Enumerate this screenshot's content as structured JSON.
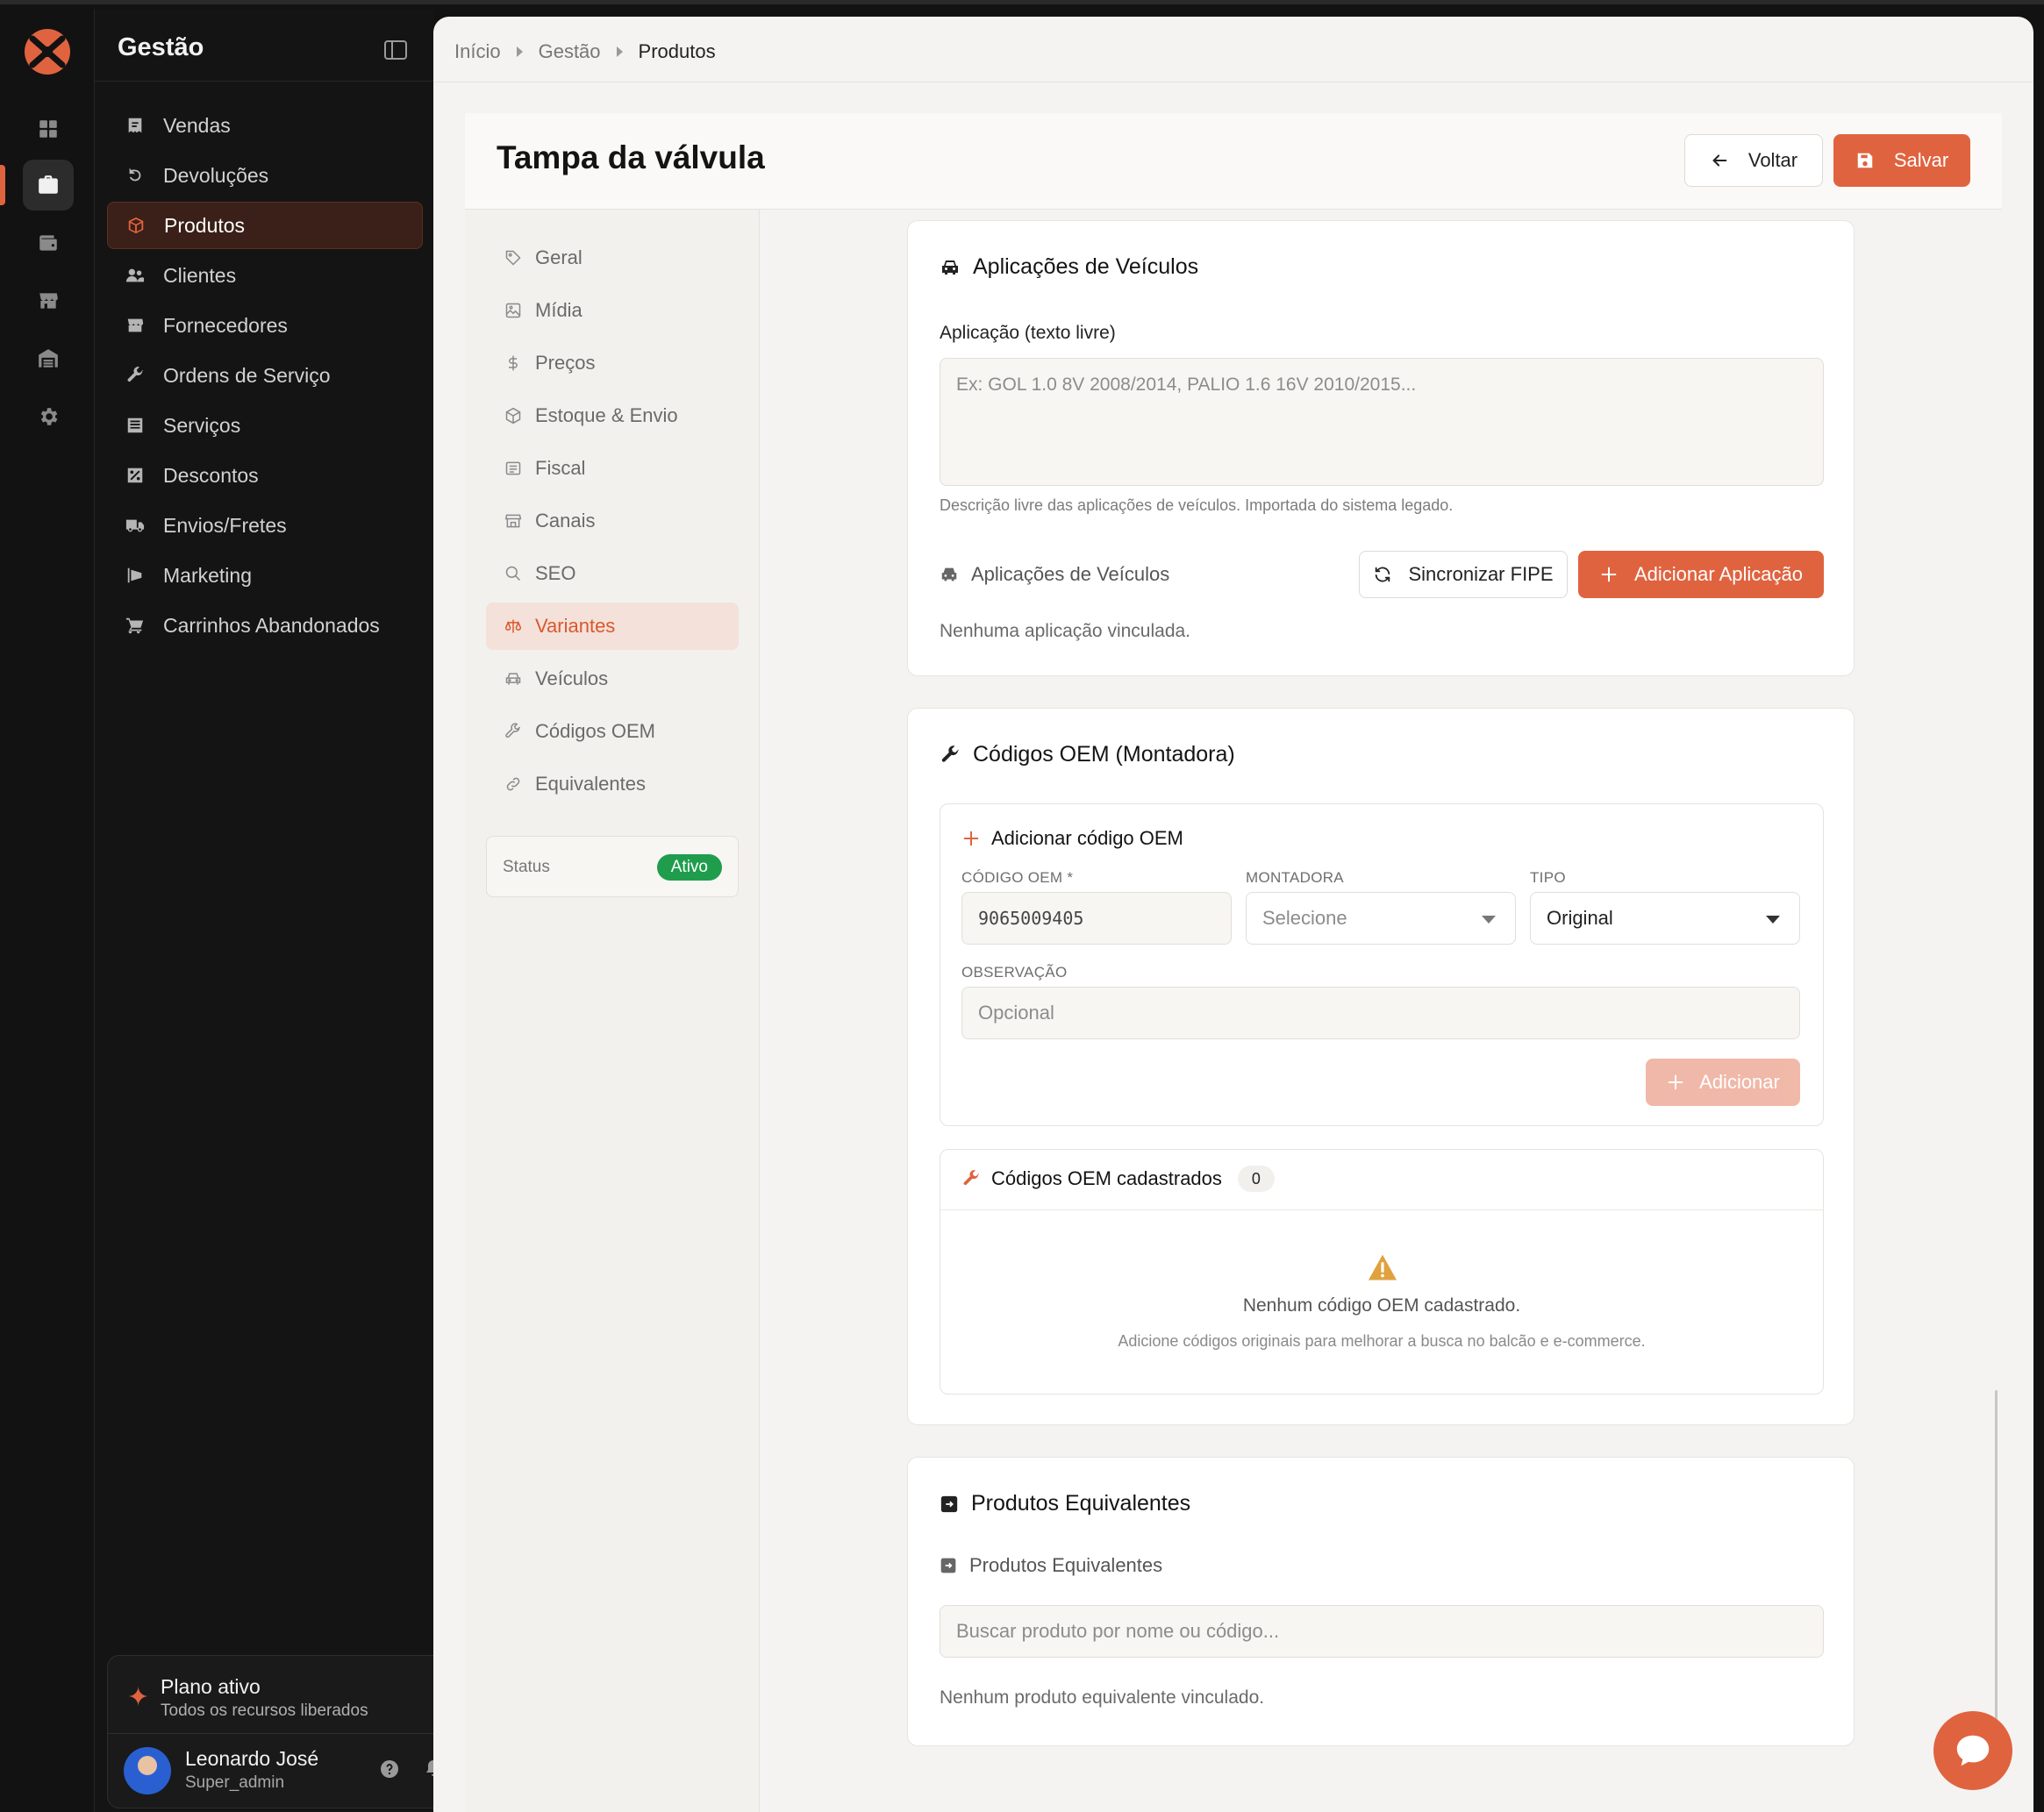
{
  "colors": {
    "accent": "#e0633f",
    "success": "#1f9d4d",
    "sidebar_bg": "#141414",
    "main_bg": "#f4f3f1"
  },
  "rail": {
    "icons": [
      "dashboard-icon",
      "briefcase-icon",
      "wallet-icon",
      "store-icon",
      "warehouse-icon",
      "gear-icon"
    ]
  },
  "sidebar": {
    "title": "Gestão",
    "items": [
      {
        "label": "Vendas",
        "icon": "receipt-icon"
      },
      {
        "label": "Devoluções",
        "icon": "undo-icon"
      },
      {
        "label": "Produtos",
        "icon": "box-icon"
      },
      {
        "label": "Clientes",
        "icon": "users-icon"
      },
      {
        "label": "Fornecedores",
        "icon": "store-icon"
      },
      {
        "label": "Ordens de Serviço",
        "icon": "wrench-icon"
      },
      {
        "label": "Serviços",
        "icon": "list-icon"
      },
      {
        "label": "Descontos",
        "icon": "percent-icon"
      },
      {
        "label": "Envios/Fretes",
        "icon": "truck-icon"
      },
      {
        "label": "Marketing",
        "icon": "megaphone-icon"
      },
      {
        "label": "Carrinhos Abandonados",
        "icon": "cart-icon"
      }
    ],
    "plan": {
      "title": "Plano ativo",
      "subtitle": "Todos os recursos liberados"
    },
    "user": {
      "name": "Leonardo José",
      "role": "Super_admin"
    }
  },
  "breadcrumb": [
    "Início",
    "Gestão",
    "Produtos"
  ],
  "header": {
    "title": "Tampa da válvula",
    "back_label": "Voltar",
    "save_label": "Salvar"
  },
  "subnav": {
    "items": [
      {
        "label": "Geral",
        "icon": "tag-icon"
      },
      {
        "label": "Mídia",
        "icon": "image-icon"
      },
      {
        "label": "Preços",
        "icon": "dollar-icon"
      },
      {
        "label": "Estoque & Envio",
        "icon": "package-icon"
      },
      {
        "label": "Fiscal",
        "icon": "document-icon"
      },
      {
        "label": "Canais",
        "icon": "store-icon"
      },
      {
        "label": "SEO",
        "icon": "search-icon"
      },
      {
        "label": "Variantes",
        "icon": "scale-icon"
      },
      {
        "label": "Veículos",
        "icon": "car-icon"
      },
      {
        "label": "Códigos OEM",
        "icon": "wrench-icon"
      },
      {
        "label": "Equivalentes",
        "icon": "link-icon"
      }
    ],
    "status_label": "Status",
    "status_value": "Ativo"
  },
  "vehicles": {
    "title": "Aplicações de Veículos",
    "field_label": "Aplicação (texto livre)",
    "textarea_placeholder": "Ex: GOL 1.0 8V 2008/2014, PALIO 1.6 16V 2010/2015...",
    "hint": "Descrição livre das aplicações de veículos. Importada do sistema legado.",
    "sub_label": "Aplicações de Veículos",
    "sync_label": "Sincronizar FIPE",
    "add_label": "Adicionar Aplicação",
    "empty": "Nenhuma aplicação vinculada."
  },
  "oem": {
    "title": "Códigos OEM (Montadora)",
    "add_title": "Adicionar código OEM",
    "code_label": "CÓDIGO OEM *",
    "code_value": "9065009405",
    "maker_label": "MONTADORA",
    "maker_value": "Selecione",
    "type_label": "TIPO",
    "type_value": "Original",
    "obs_label": "OBSERVAÇÃO",
    "obs_placeholder": "Opcional",
    "add_button": "Adicionar",
    "list_title": "Códigos OEM cadastrados",
    "list_count": "0",
    "empty_title": "Nenhum código OEM cadastrado.",
    "empty_sub": "Adicione códigos originais para melhorar a busca no balcão e e-commerce."
  },
  "equivalents": {
    "title": "Produtos Equivalentes",
    "sub_label": "Produtos Equivalentes",
    "search_placeholder": "Buscar produto por nome ou código...",
    "empty": "Nenhum produto equivalente vinculado."
  }
}
